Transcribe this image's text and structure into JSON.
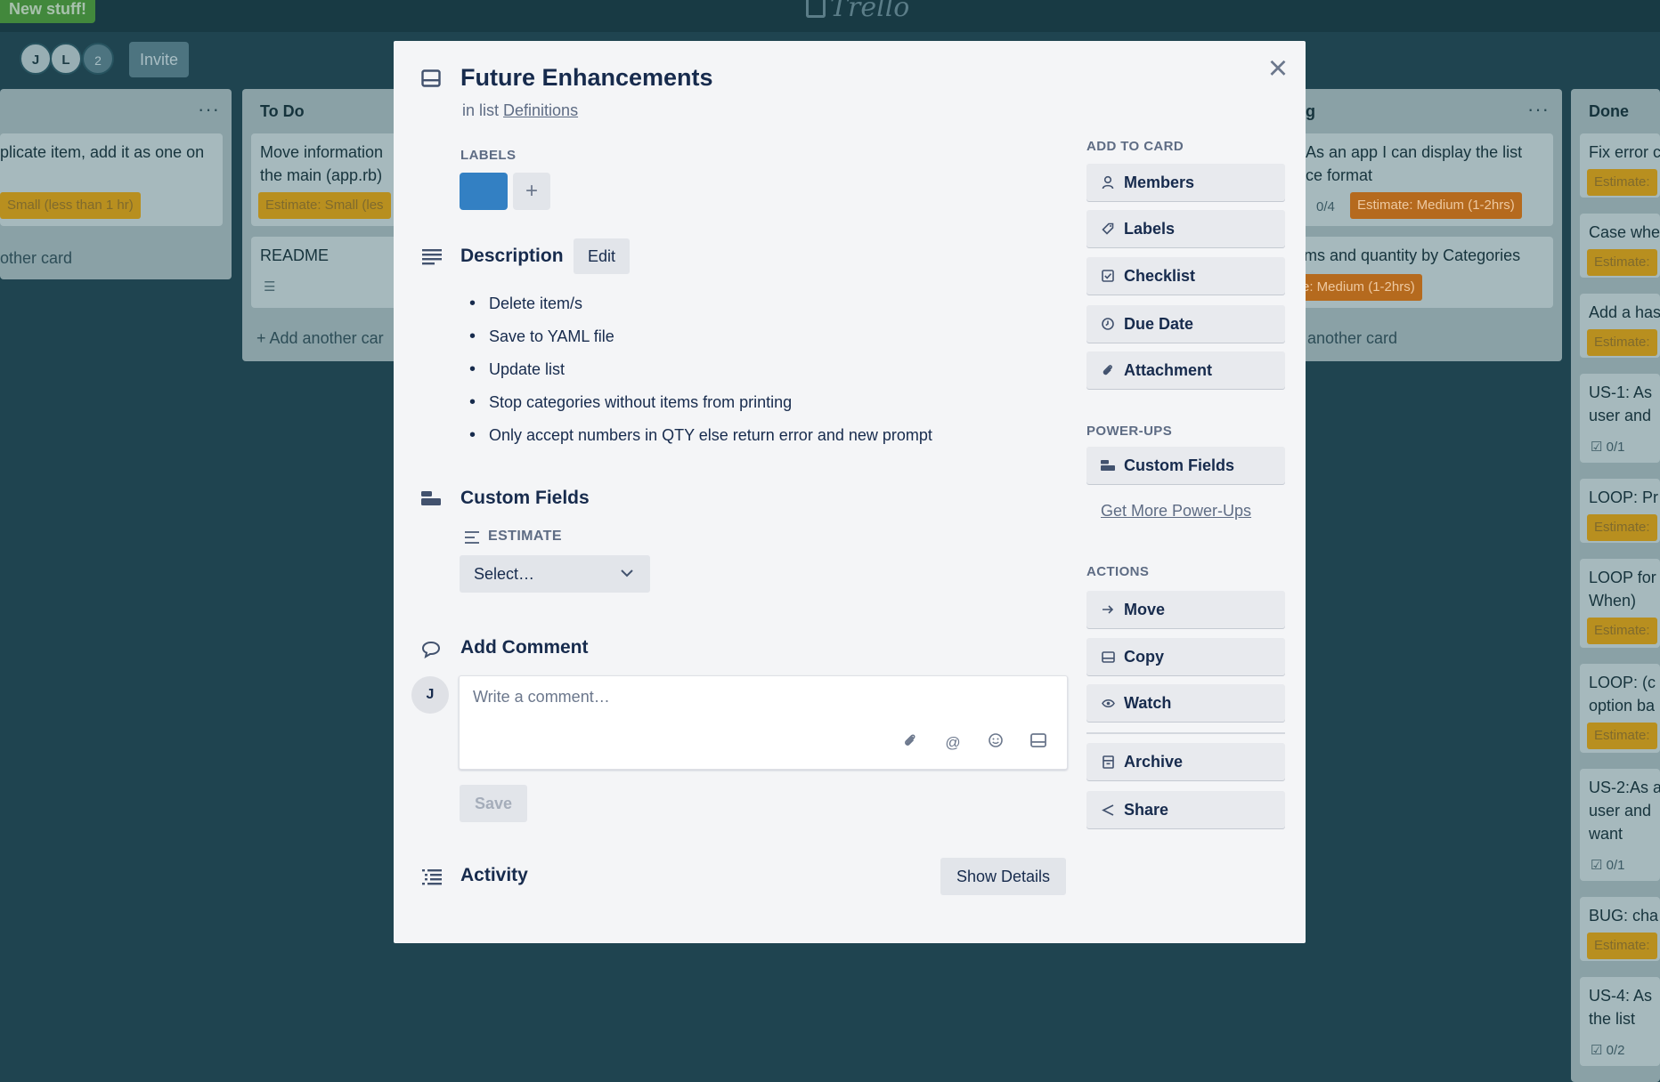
{
  "topbar": {
    "new_stuff": "New stuff!",
    "logo": "Trello"
  },
  "members": [
    "J",
    "L"
  ],
  "member_count": "2",
  "invite_label": "Invite",
  "lists": {
    "first": {
      "card1_text": "plicate item, add it as one on",
      "card1_badge": "Small (less than 1 hr)",
      "add_card": "other card"
    },
    "todo": {
      "title": "To Do",
      "card1_line1": "Move information",
      "card1_line2": "the main (app.rb)",
      "card1_badge": "Estimate: Small (les",
      "card2_text": "README",
      "add_card": "+ Add another car"
    },
    "doing": {
      "title": "g",
      "card1_line1": "As an app I can display the list",
      "card1_line2": "ce format",
      "card1_count": "0/4",
      "card1_badge": "Estimate: Medium (1-2hrs)",
      "card2_line1": "ems and quantity by Categories",
      "card2_badge": "e: Medium (1-2hrs)",
      "add_card": "another card"
    },
    "done": {
      "title": "Done",
      "cards": [
        {
          "text": "Fix error c",
          "badge": "Estimate:"
        },
        {
          "text": "Case whe",
          "badge": "Estimate:"
        },
        {
          "text": "Add a has",
          "badge": "Estimate:"
        },
        {
          "text": "US-1: As",
          "text2": "user and",
          "count": "0/1"
        },
        {
          "text": "LOOP: Pr",
          "badge": "Estimate:"
        },
        {
          "text": "LOOP for",
          "text2": "When)",
          "badge": "Estimate:"
        },
        {
          "text": "LOOP: (c",
          "text2": "option ba",
          "badge": "Estimate:"
        },
        {
          "text": "US-2:As a",
          "text2": "user and",
          "text3": "want",
          "count": "0/1"
        },
        {
          "text": "BUG: cha",
          "badge": "Estimate:"
        },
        {
          "text": "US-4: As",
          "text2": "the list",
          "count": "0/2"
        }
      ]
    }
  },
  "modal": {
    "title": "Future Enhancements",
    "in_list_prefix": "in list",
    "list_name": "Definitions",
    "labels_heading": "LABELS",
    "label_color": "#3380c3",
    "add_label": "+",
    "description_title": "Description",
    "edit_label": "Edit",
    "description_items": [
      "Delete item/s",
      "Save to YAML file",
      "Update list",
      "Stop categories without items from printing",
      "Only accept numbers in QTY else return error and new prompt"
    ],
    "custom_fields_title": "Custom Fields",
    "estimate_label": "ESTIMATE",
    "estimate_value": "Select…",
    "add_comment_title": "Add Comment",
    "avatar_initial": "J",
    "comment_placeholder": "Write a comment…",
    "save_label": "Save",
    "activity_title": "Activity",
    "show_details_label": "Show Details"
  },
  "sidebar": {
    "add_to_card_heading": "ADD TO CARD",
    "add_to_card": [
      {
        "label": "Members",
        "icon": "person-icon"
      },
      {
        "label": "Labels",
        "icon": "tag-icon"
      },
      {
        "label": "Checklist",
        "icon": "checkbox-icon"
      },
      {
        "label": "Due Date",
        "icon": "clock-icon"
      },
      {
        "label": "Attachment",
        "icon": "paperclip-icon"
      }
    ],
    "powerups_heading": "POWER-UPS",
    "custom_fields_button": "Custom Fields",
    "get_more_powerups": "Get More Power-Ups",
    "actions_heading": "ACTIONS",
    "actions": [
      {
        "label": "Move",
        "icon": "arrow-right-icon"
      },
      {
        "label": "Copy",
        "icon": "card-icon"
      },
      {
        "label": "Watch",
        "icon": "eye-icon"
      },
      {
        "label": "Archive",
        "icon": "archive-icon"
      },
      {
        "label": "Share",
        "icon": "share-icon"
      }
    ]
  },
  "colors": {
    "board_bg": "#1f4450",
    "label_blue": "#3380c3",
    "badge_yellow": "#b88f1f",
    "badge_orange": "#b56a1e"
  }
}
